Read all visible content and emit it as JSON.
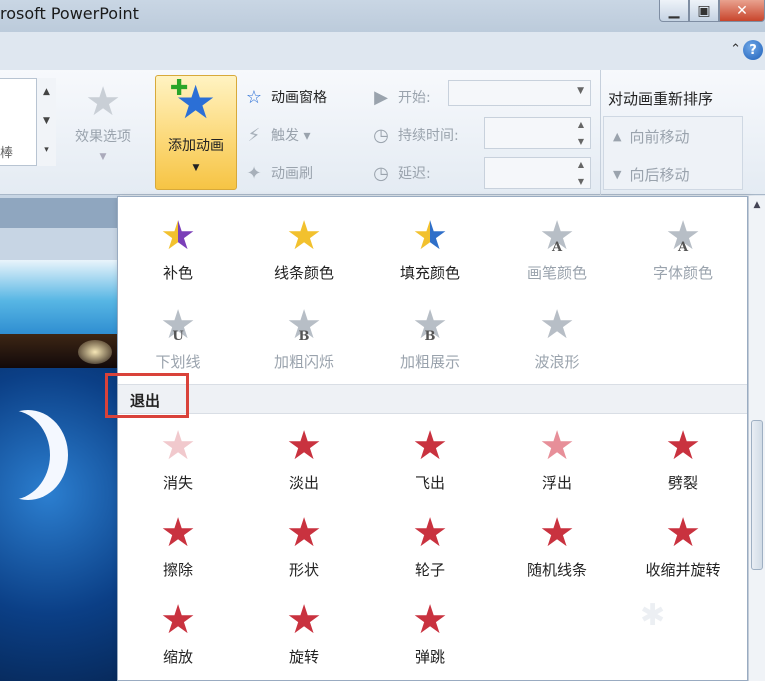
{
  "window": {
    "title": "rosoft PowerPoint",
    "minimize_glyph": "▁",
    "maximize_glyph": "▣",
    "close_glyph": "✕",
    "help_glyph": "?",
    "collapse_glyph": "⌃"
  },
  "ribbon": {
    "partial_char": "棒",
    "effect_options": {
      "label": "效果选项"
    },
    "add_animation": {
      "label": "添加动画"
    },
    "advanced": {
      "animation_pane": "动画窗格",
      "trigger": "触发 ▾",
      "animation_painter": "动画刷"
    },
    "timing": {
      "start_label": "开始:",
      "duration_label": "持续时间:",
      "delay_label": "延迟:",
      "start_value": "",
      "duration_value": "",
      "delay_value": ""
    },
    "reorder": {
      "header": "对动画重新排序",
      "move_earlier": "向前移动",
      "move_later": "向后移动"
    }
  },
  "gallery": {
    "emphasis_row1": [
      {
        "label": "补色",
        "icon": "star-purple-gold-icon",
        "enabled": true
      },
      {
        "label": "线条颜色",
        "icon": "star-outline-gold-icon",
        "enabled": true
      },
      {
        "label": "填充颜色",
        "icon": "star-gold-blue-icon",
        "enabled": true
      },
      {
        "label": "画笔颜色",
        "icon": "star-letter-a-icon",
        "enabled": false,
        "letter": "A"
      },
      {
        "label": "字体颜色",
        "icon": "star-letter-a-icon",
        "enabled": false,
        "letter": "A"
      }
    ],
    "emphasis_row2": [
      {
        "label": "下划线",
        "icon": "star-letter-u-icon",
        "enabled": false,
        "letter": "U"
      },
      {
        "label": "加粗闪烁",
        "icon": "burst-letter-b-icon",
        "enabled": false,
        "letter": "B"
      },
      {
        "label": "加粗展示",
        "icon": "star-letter-b-icon",
        "enabled": false,
        "letter": "B"
      },
      {
        "label": "波浪形",
        "icon": "star-wave-icon",
        "enabled": false
      }
    ],
    "exit_section": {
      "title": "退出"
    },
    "exit_row1": [
      {
        "label": "消失",
        "icon": "star-disappear-icon"
      },
      {
        "label": "淡出",
        "icon": "star-fade-icon"
      },
      {
        "label": "飞出",
        "icon": "star-fly-out-icon"
      },
      {
        "label": "浮出",
        "icon": "star-float-out-icon"
      },
      {
        "label": "劈裂",
        "icon": "star-split-icon"
      }
    ],
    "exit_row2": [
      {
        "label": "擦除",
        "icon": "star-wipe-icon"
      },
      {
        "label": "形状",
        "icon": "star-shape-icon"
      },
      {
        "label": "轮子",
        "icon": "star-wheel-icon"
      },
      {
        "label": "随机线条",
        "icon": "star-random-bars-icon"
      },
      {
        "label": "收缩并旋转",
        "icon": "star-shrink-turn-icon"
      }
    ],
    "exit_row3": [
      {
        "label": "缩放",
        "icon": "star-zoom-icon"
      },
      {
        "label": "旋转",
        "icon": "star-swivel-icon"
      },
      {
        "label": "弹跳",
        "icon": "star-bounce-icon"
      }
    ]
  },
  "colors": {
    "exit_star": "#c9323f",
    "emphasis_gold": "#f2c12e",
    "emphasis_purple": "#7b3fb8",
    "emphasis_blue": "#2f6fc9",
    "disabled": "#b7bec6",
    "highlight_box": "#d9423a"
  }
}
